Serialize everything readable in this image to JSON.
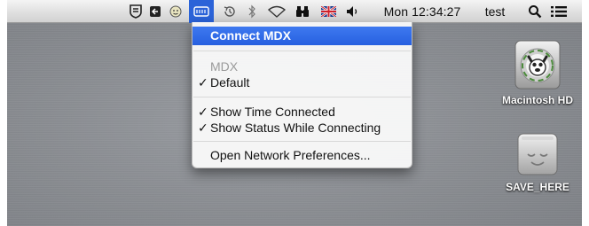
{
  "menubar": {
    "status_icons": [
      "shield-menu-icon",
      "flip-window-icon",
      "face-menu-icon",
      "mdx-menu-icon",
      "time-machine-icon",
      "bluetooth-icon",
      "wifi-icon",
      "binoculars-icon",
      "uk-flag-icon",
      "volume-icon"
    ],
    "clock": "Mon 12:34:27",
    "user": "test",
    "search_icon": "spotlight-search-icon",
    "list_icon": "menu-list-icon"
  },
  "dropdown": {
    "items": [
      {
        "label": "Connect MDX",
        "state": "highlighted"
      },
      {
        "label": "MDX",
        "state": "disabled"
      },
      {
        "label": "Default",
        "checked": true
      },
      {
        "label": "Show Time Connected",
        "checked": true
      },
      {
        "label": "Show Status While Connecting",
        "checked": true
      },
      {
        "label": "Open Network Preferences...",
        "checked": false
      }
    ],
    "check_glyph": "✓"
  },
  "desktop": {
    "icons": [
      {
        "label": "Macintosh HD",
        "icon": "hard-drive-icon"
      },
      {
        "label": "SAVE_HERE",
        "icon": "hard-drive-icon"
      }
    ]
  },
  "colors": {
    "highlight": "#2b63d8",
    "menubar": "#dedede",
    "desktop": "#8b8e93"
  }
}
